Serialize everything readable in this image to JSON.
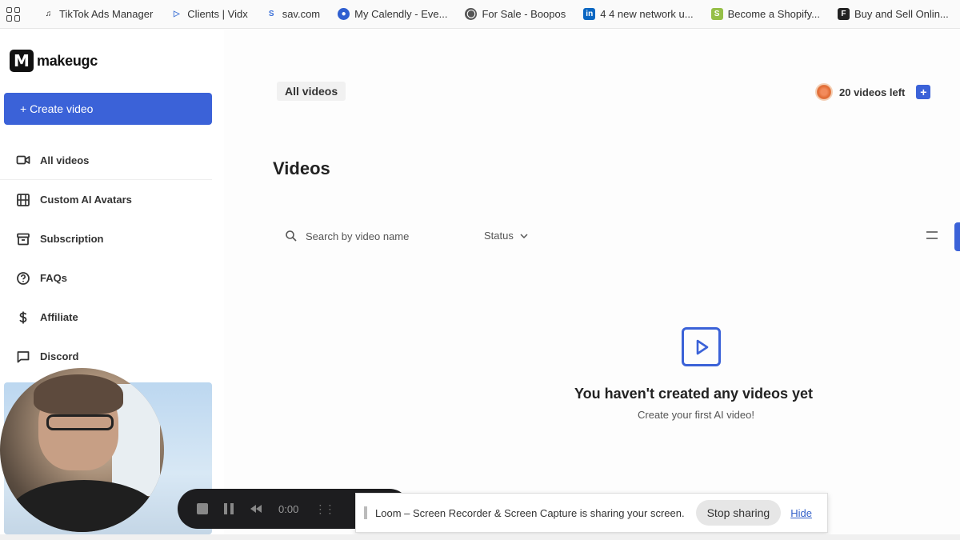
{
  "bookmarks": [
    {
      "label": "TikTok Ads Manager",
      "icon": "tiktok-icon",
      "color": "#111111"
    },
    {
      "label": "Clients | Vidx",
      "icon": "vidx-icon",
      "color": "#4a7bd8"
    },
    {
      "label": "sav.com",
      "icon": "sav-icon",
      "color": "#3a6fd8"
    },
    {
      "label": "My Calendly - Eve...",
      "icon": "calendly-icon",
      "color": "#2f5fd0"
    },
    {
      "label": "For Sale - Boopos",
      "icon": "globe-icon",
      "color": "#555555"
    },
    {
      "label": "4 4 new network u...",
      "icon": "linkedin-icon",
      "color": "#0a66c2"
    },
    {
      "label": "Become a Shopify...",
      "icon": "shopify-icon",
      "color": "#95bf47"
    },
    {
      "label": "Buy and Sell Onlin...",
      "icon": "flippa-icon",
      "color": "#222222"
    }
  ],
  "logo": {
    "mark": "M",
    "text": "makeugc"
  },
  "sidebar": {
    "create_label": "+ Create video",
    "items": [
      {
        "label": "All videos",
        "icon": "video-camera-icon"
      },
      {
        "label": "Custom AI Avatars",
        "icon": "film-icon"
      },
      {
        "label": "Subscription",
        "icon": "archive-icon"
      },
      {
        "label": "FAQs",
        "icon": "help-circle-icon"
      },
      {
        "label": "Affiliate",
        "icon": "dollar-icon"
      },
      {
        "label": "Discord",
        "icon": "chat-icon"
      }
    ]
  },
  "header": {
    "tab": "All videos",
    "videos_left": "20 videos left"
  },
  "main": {
    "title": "Videos",
    "search_placeholder": "Search by video name",
    "status_label": "Status",
    "empty_title": "You haven't created any videos yet",
    "empty_subtitle": "Create your first AI video!"
  },
  "loom": {
    "timer": "0:00",
    "share_text": "Loom – Screen Recorder & Screen Capture is sharing your screen.",
    "stop_label": "Stop sharing",
    "hide_label": "Hide"
  },
  "colors": {
    "accent": "#3b62d8"
  }
}
